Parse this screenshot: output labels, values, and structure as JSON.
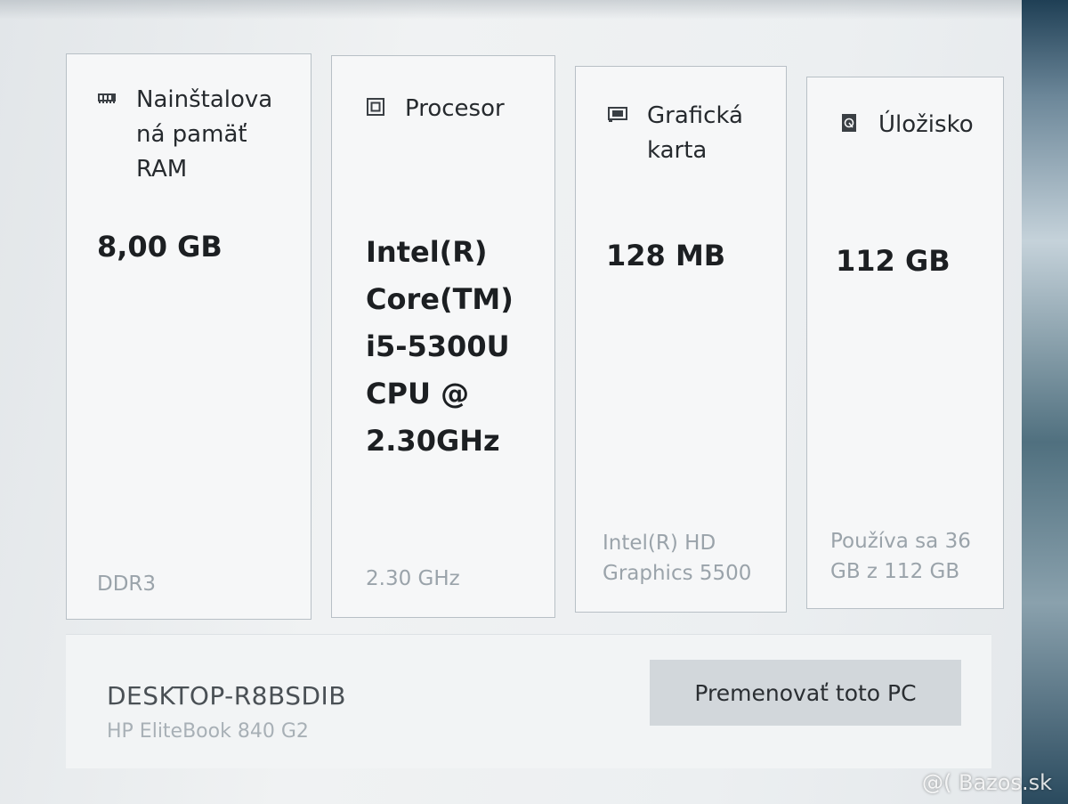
{
  "cards": {
    "ram": {
      "title": "Nainštalova\nná pamäť\nRAM",
      "value": "8,00 GB",
      "detail": "DDR3",
      "icon": "memory-icon"
    },
    "cpu": {
      "title": "Procesor",
      "value": "Intel(R)\nCore(TM)\ni5-5300U\nCPU @\n2.30GHz",
      "detail": "2.30 GHz",
      "icon": "processor-icon"
    },
    "gpu": {
      "title": "Grafická\nkarta",
      "value": "128 MB",
      "detail": "Intel(R) HD\nGraphics 5500",
      "icon": "graphics-card-icon"
    },
    "storage": {
      "title": "Úložisko",
      "value": "112 GB",
      "detail": "Používa sa 36\nGB z 112 GB",
      "icon": "storage-drive-icon"
    }
  },
  "device": {
    "name": "DESKTOP-R8BSDIB",
    "model": "HP EliteBook 840 G2",
    "rename_label": "Premenovať toto PC"
  },
  "watermark": "@( Bazos.sk"
}
